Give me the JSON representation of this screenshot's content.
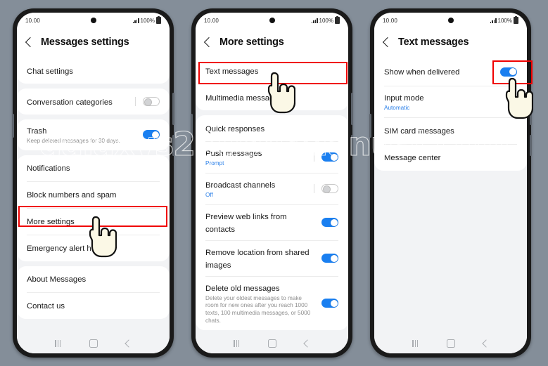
{
  "watermark": "galaxys23usermanual.com",
  "colors": {
    "background": "#848e99",
    "accent_blue": "#1a7ff0",
    "highlight_red": "#f00000",
    "panel": "#f2f3f5"
  },
  "status_bar": {
    "time": "10.00",
    "battery_percent": "100%",
    "signal_icon": "signal-bars-icon",
    "battery_icon": "battery-full-icon",
    "camera_icon": "front-camera-punch-hole"
  },
  "nav_bar": {
    "recents_icon": "recents-icon",
    "home_icon": "home-icon",
    "back_icon": "back-icon"
  },
  "phones": [
    {
      "id": "phone-1",
      "title": "Messages settings",
      "back_icon": "back-chevron-icon",
      "sections": [
        {
          "items": [
            {
              "label": "Chat settings",
              "sub": null,
              "toggle": null
            }
          ]
        },
        {
          "items": [
            {
              "label": "Conversation categories",
              "sub": null,
              "toggle": "off"
            }
          ]
        },
        {
          "items": [
            {
              "label": "Trash",
              "sub": "Keep deleted messages for 30 days.",
              "toggle": "on"
            }
          ]
        },
        {
          "items": [
            {
              "label": "Notifications",
              "sub": null,
              "toggle": null
            },
            {
              "label": "Block numbers and spam",
              "sub": null,
              "toggle": null
            },
            {
              "label": "More settings",
              "sub": null,
              "toggle": null,
              "highlighted": true
            },
            {
              "label": "Emergency alert h",
              "sub": null,
              "toggle": null
            }
          ]
        },
        {
          "items": [
            {
              "label": "About Messages",
              "sub": null,
              "toggle": null
            },
            {
              "label": "Contact us",
              "sub": null,
              "toggle": null
            }
          ]
        }
      ],
      "pointer": {
        "type": "hand-pointer-icon",
        "target": "More settings"
      }
    },
    {
      "id": "phone-2",
      "title": "More settings",
      "back_icon": "back-chevron-icon",
      "sections": [
        {
          "items": [
            {
              "label": "Text messages",
              "sub": null,
              "toggle": null,
              "highlighted": true
            },
            {
              "label": "Multimedia message",
              "sub": null,
              "toggle": null
            }
          ]
        },
        {
          "items": [
            {
              "label": "Quick responses",
              "sub": null,
              "toggle": null
            },
            {
              "label": "Push messages",
              "sub": "Prompt",
              "sub_blue": true,
              "toggle": "on"
            },
            {
              "label": "Broadcast channels",
              "sub": "Off",
              "sub_blue": true,
              "toggle": "off"
            },
            {
              "label": "Preview web links from contacts",
              "sub": null,
              "toggle": "on"
            },
            {
              "label": "Remove location from shared images",
              "sub": null,
              "toggle": "on"
            },
            {
              "label": "Delete old messages",
              "sub": "Delete your oldest messages to make room for new ones after you reach 1000 texts, 100 multimedia messages, or 5000 chats.",
              "toggle": "on"
            }
          ]
        }
      ],
      "pointer": {
        "type": "hand-pointer-icon",
        "target": "Text messages"
      }
    },
    {
      "id": "phone-3",
      "title": "Text messages",
      "back_icon": "back-chevron-icon",
      "sections": [
        {
          "items": [
            {
              "label": "Show when delivered",
              "sub": null,
              "toggle": "on",
              "toggle_highlighted": true
            },
            {
              "label": "Input mode",
              "sub": "Automatic",
              "sub_blue": true,
              "toggle": null
            },
            {
              "label": "SIM card messages",
              "sub": null,
              "toggle": null
            },
            {
              "label": "Message center",
              "sub": null,
              "toggle": null
            }
          ]
        }
      ],
      "pointer": {
        "type": "hand-pointer-icon",
        "target": "Show when delivered toggle"
      }
    }
  ]
}
